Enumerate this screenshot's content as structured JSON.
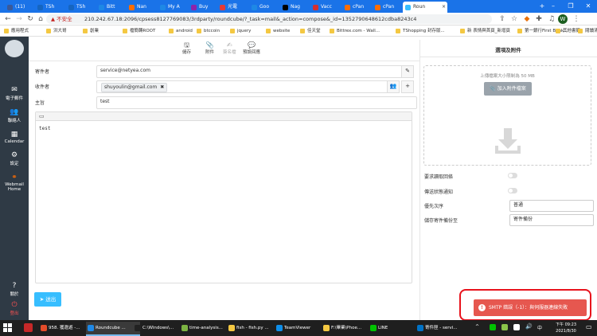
{
  "browser": {
    "tabs": [
      {
        "label": "(11)",
        "color": "#3b5998"
      },
      {
        "label": "TSh",
        "color": "#1565c0"
      },
      {
        "label": "TSh",
        "color": "#1565c0"
      },
      {
        "label": "Bitt",
        "color": "#1e88e5"
      },
      {
        "label": "Nan",
        "color": "#ff6d00"
      },
      {
        "label": "My A",
        "color": "#1e88e5"
      },
      {
        "label": "Buy",
        "color": "#8e24aa"
      },
      {
        "label": "光電",
        "color": "#e53935"
      },
      {
        "label": "Goo",
        "color": "#1e88e5"
      },
      {
        "label": "Nag",
        "color": "#000000"
      },
      {
        "label": "Vacc",
        "color": "#d32f2f"
      },
      {
        "label": "cPan",
        "color": "#ff6d00"
      },
      {
        "label": "cPan",
        "color": "#ff6d00"
      },
      {
        "label": "Roun",
        "color": "#37beff"
      }
    ],
    "new_tab": "+",
    "window_buttons": [
      "–",
      "❐",
      "✕"
    ],
    "security_label": "▲ 不安全",
    "url": "210.242.67.18:2096/cpsess8127769083/3rdparty/roundcube/?_task=mail&_action=compose&_id=1352790648612cdba8243c4",
    "profile_initial": "W",
    "bookmarks": [
      "應用程式",
      "洪大哥",
      "創業",
      "檔簡轉ROOT",
      "android",
      "btccoin",
      "jquery",
      "website",
      "佳天堂",
      "Bittrex.com - Wall...",
      "TShopping 封存版...",
      "新 表情與首頁_新增頁",
      "第一銀行First Bank...",
      "其他書籤",
      "閱讀清單"
    ]
  },
  "app_nav": {
    "items": [
      {
        "label": "撰寫新郵件",
        "icon": "✎",
        "name": "compose"
      },
      {
        "label": "電子郵件",
        "icon": "✉",
        "name": "mail"
      },
      {
        "label": "聯絡人",
        "icon": "👥",
        "name": "contacts"
      },
      {
        "label": "Calendar",
        "icon": "▦",
        "name": "calendar"
      },
      {
        "label": "設定",
        "icon": "⚙",
        "name": "settings"
      },
      {
        "label": "Webmail Home",
        "icon": "⚭",
        "name": "webmail-home"
      }
    ],
    "about": {
      "label": "關於",
      "icon": "?"
    },
    "logout": {
      "label": "登出",
      "icon": "⏻"
    }
  },
  "toolbar": {
    "save": {
      "label": "儲存",
      "icon": "🖫"
    },
    "attach": {
      "label": "附件",
      "icon": "📎"
    },
    "signature": {
      "label": "簽名檔",
      "icon": "✍"
    },
    "responses": {
      "label": "預設回應",
      "icon": "💬"
    }
  },
  "compose": {
    "from_label": "寄件者",
    "from_value": "service@netyea.com",
    "to_label": "收件者",
    "to_recipient": "shuyoulin@gmail.com",
    "subject_label": "主旨",
    "subject_value": "test",
    "body": "test",
    "send_label": "送出"
  },
  "options": {
    "title": "選項及附件",
    "upload_hint": "上傳檔案大小限制為 50 MB",
    "add_attachment_label": "加入附件檔案",
    "read_receipt_label": "要求讀取回條",
    "delivery_status_label": "傳送狀態通知",
    "priority_label": "優先次序",
    "priority_value": "普通",
    "save_sent_label": "儲存寄件備份至",
    "save_sent_value": "寄件備份"
  },
  "notification": {
    "message": "SMTP 錯誤（-1）：與伺服器連線失敗",
    "color": "#e6574f",
    "highlight_color": "#e8121c"
  },
  "taskbar": {
    "items": [
      {
        "label": "958. 獲邀遊 -...",
        "color": "#e44c2a"
      },
      {
        "label": "Roundcube ...",
        "color": "#1e88e5"
      },
      {
        "label": "C:\\Windows\\...",
        "color": "#222222"
      },
      {
        "label": "time-analysis...",
        "color": "#7cb342"
      },
      {
        "label": "fish - fish.py ...",
        "color": "#f4c842"
      },
      {
        "label": "TeamViewer",
        "color": "#0e8ee9"
      },
      {
        "label": "F:\\畢業\\Phoe...",
        "color": "#f4c842"
      },
      {
        "label": "LINE",
        "color": "#00c300"
      },
      {
        "label": "寄件匣 - servi...",
        "color": "#0072c6"
      }
    ],
    "time": "下午 09:23",
    "date": "2021/8/30"
  }
}
